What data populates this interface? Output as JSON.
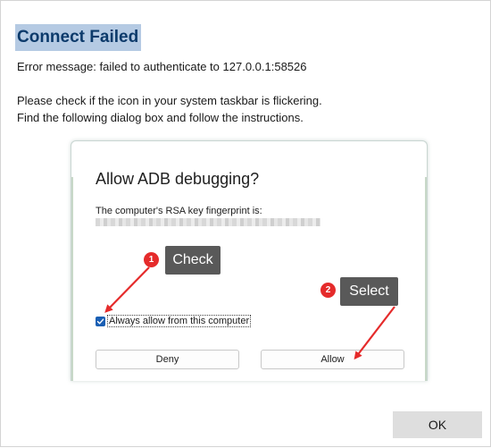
{
  "dialog": {
    "title": "Connect Failed",
    "error_message": "Error message: failed to authenticate to 127.0.0.1:58526",
    "instructions": [
      "Please check if the icon in your system taskbar is flickering.",
      "Find the following dialog box and follow the instructions."
    ],
    "ok_label": "OK"
  },
  "adb_prompt": {
    "title": "Allow ADB debugging?",
    "rsa_label": "The computer's RSA key fingerprint is:",
    "checkbox_label": "Always allow from this computer",
    "checkbox_checked": true,
    "deny_label": "Deny",
    "allow_label": "Allow"
  },
  "annotations": {
    "step1": {
      "number": "1",
      "label": "Check"
    },
    "step2": {
      "number": "2",
      "label": "Select"
    },
    "accent_color": "#e52b2b",
    "callout_color": "#595959"
  }
}
